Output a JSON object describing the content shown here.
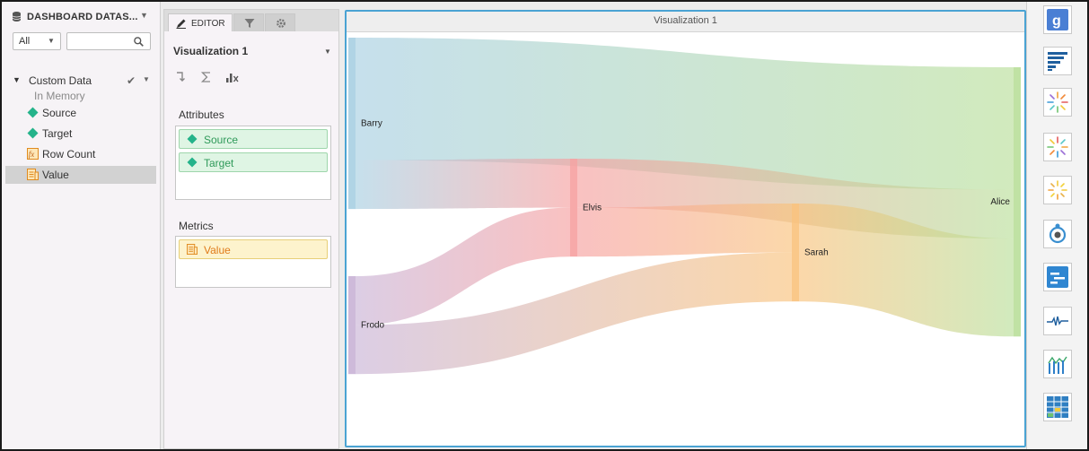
{
  "dataset_panel": {
    "title": "DASHBOARD DATAS...",
    "filter_value": "All",
    "search_placeholder": "",
    "source": {
      "name": "Custom Data",
      "subtitle": "In Memory"
    },
    "fields": [
      {
        "label": "Source",
        "kind": "attribute",
        "icon": "attribute-diamond-icon"
      },
      {
        "label": "Target",
        "kind": "attribute",
        "icon": "attribute-diamond-icon"
      },
      {
        "label": "Row Count",
        "kind": "derived-metric",
        "icon": "fx-icon"
      },
      {
        "label": "Value",
        "kind": "metric",
        "icon": "metric-icon",
        "selected": true
      }
    ]
  },
  "editor": {
    "tabs": [
      {
        "label": "EDITOR",
        "icon": "pencil-icon",
        "active": true
      },
      {
        "label": "",
        "icon": "filter-icon"
      },
      {
        "label": "",
        "icon": "gear-icon"
      }
    ],
    "viz_name": "Visualization 1",
    "toolbar_icons": [
      "swap-axes-icon",
      "sigma-icon",
      "chart-sort-icon"
    ],
    "attributes_title": "Attributes",
    "attributes": [
      "Source",
      "Target"
    ],
    "metrics_title": "Metrics",
    "metrics": [
      "Value"
    ]
  },
  "visualization": {
    "title": "Visualization 1",
    "chart_data": {
      "type": "sankey",
      "nodes": [
        "Barry",
        "Frodo",
        "Elvis",
        "Sarah",
        "Alice"
      ],
      "links": [
        {
          "source": "Barry",
          "target": "Alice",
          "value": 5
        },
        {
          "source": "Barry",
          "target": "Elvis",
          "value": 2
        },
        {
          "source": "Frodo",
          "target": "Elvis",
          "value": 2
        },
        {
          "source": "Frodo",
          "target": "Sarah",
          "value": 2
        },
        {
          "source": "Elvis",
          "target": "Alice",
          "value": 2
        },
        {
          "source": "Elvis",
          "target": "Sarah",
          "value": 2
        },
        {
          "source": "Sarah",
          "target": "Alice",
          "value": 4
        }
      ],
      "node_colors": {
        "Barry": "#a7cfe2",
        "Frodo": "#c9b3d6",
        "Elvis": "#f6a0a0",
        "Sarah": "#f9c27c",
        "Alice": "#b9df9a"
      }
    }
  },
  "gallery": {
    "items": [
      {
        "name": "google-maps-viz-icon"
      },
      {
        "name": "bar-chart-viz-icon"
      },
      {
        "name": "sunburst-viz-icon"
      },
      {
        "name": "sunburst-alt-viz-icon"
      },
      {
        "name": "radial-viz-icon"
      },
      {
        "name": "network-viz-icon"
      },
      {
        "name": "gantt-viz-icon"
      },
      {
        "name": "sparkline-viz-icon"
      },
      {
        "name": "waterfall-viz-icon"
      },
      {
        "name": "heat-map-viz-icon"
      }
    ]
  }
}
